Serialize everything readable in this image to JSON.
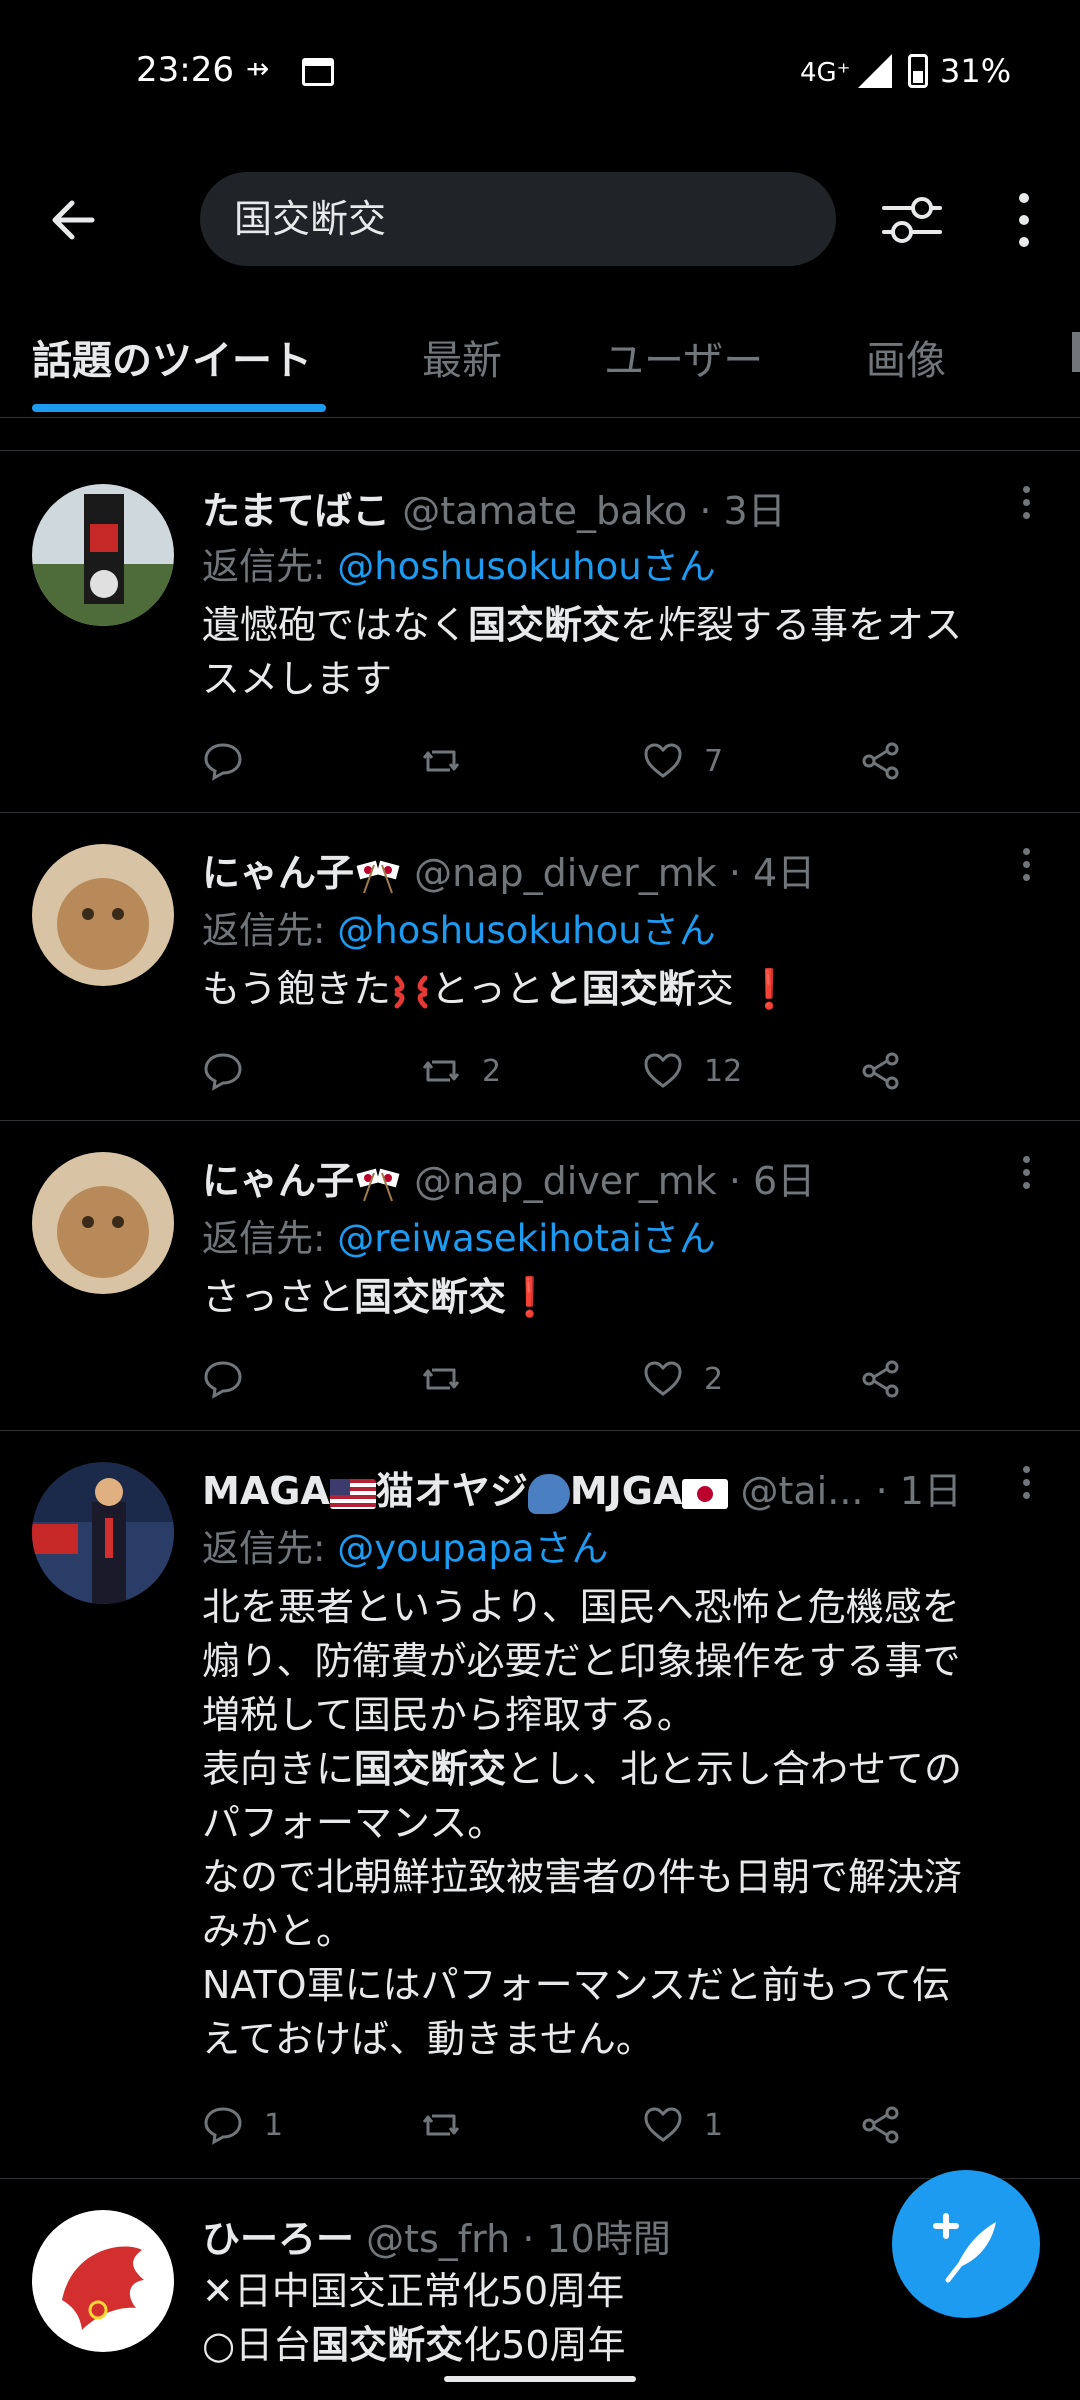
{
  "status_bar": {
    "time": "23:26",
    "network": "4G⁺",
    "battery": "31%"
  },
  "search": {
    "query": "国交断交"
  },
  "tabs": [
    {
      "label": "話題のツイート",
      "active": true
    },
    {
      "label": "最新"
    },
    {
      "label": "ユーザー"
    },
    {
      "label": "画像"
    }
  ],
  "tweets": [
    {
      "name": "たまてばこ",
      "handle": "@tamate_bako",
      "time": "· 3日",
      "reply_prefix": "返信先:",
      "reply_to": "@hoshusokuhouさん",
      "body_a": "遺憾砲ではなく",
      "body_bold": "国交断交",
      "body_b": "を炸裂する事をオス\nスメします",
      "counts": {
        "reply": "",
        "retweet": "",
        "like": "7"
      }
    },
    {
      "name": "にゃん子",
      "handle": "@nap_diver_mk",
      "time": "· 4日",
      "reply_prefix": "返信先:",
      "reply_to": "@hoshusokuhouさん",
      "body_a": "もう飽きた",
      "body_mid": "とっと",
      "body_bold": "と国交断",
      "body_b": "交",
      "counts": {
        "reply": "",
        "retweet": "2",
        "like": "12"
      }
    },
    {
      "name": "にゃん子",
      "handle": "@nap_diver_mk",
      "time": "· 6日",
      "reply_prefix": "返信先:",
      "reply_to": "@reiwasekihotaiさん",
      "body_a": "さっさと",
      "body_bold": "国交断交",
      "counts": {
        "reply": "",
        "retweet": "",
        "like": "2"
      }
    },
    {
      "name_a": "MAGA",
      "name_b": "猫オヤジ",
      "name_c": "MJGA",
      "handle": "@tai...",
      "time": "· 1日",
      "reply_prefix": "返信先:",
      "reply_to": "@youpapaさん",
      "body_a": "北を悪者というより、国民へ恐怖と危機感を\n煽り、防衛費が必要だと印象操作をする事で\n増税して国民から搾取する。\n表向きに",
      "body_bold": "国交断交",
      "body_b": "とし、北と示し合わせての\nパフォーマンス。\nなので北朝鮮拉致被害者の件も日朝で解決済\nみかと。\nNATO軍にはパフォーマンスだと前もって伝\nえておけば、動きません。",
      "counts": {
        "reply": "1",
        "retweet": "",
        "like": "1"
      }
    },
    {
      "name": "ひーろー",
      "handle": "@ts_frh",
      "time": "· 10時間",
      "body_a": "✕日中国交正常化50周年\n○日台",
      "body_bold": "国交断交",
      "body_b": "化50周年"
    }
  ],
  "colors": {
    "accent": "#1d9bf0",
    "background": "#000000",
    "muted": "#71767b"
  }
}
